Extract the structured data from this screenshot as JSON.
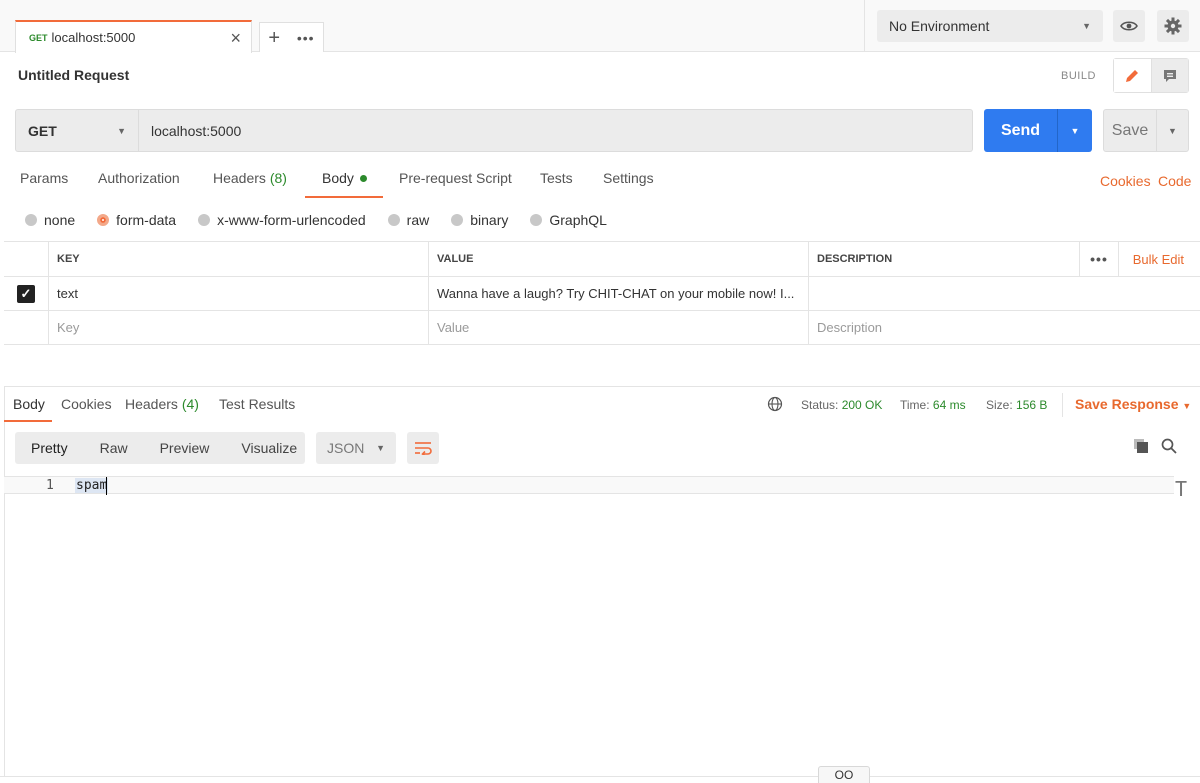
{
  "tabs": {
    "active_method": "GET",
    "active_title": "localhost:5000",
    "close_glyph": "×",
    "new_tab_glyph": "+",
    "more_glyph": "•••"
  },
  "environment": {
    "selected": "No Environment"
  },
  "request": {
    "title": "Untitled Request",
    "mode_label": "BUILD",
    "method": "GET",
    "url": "localhost:5000",
    "send_label": "Send",
    "save_label": "Save"
  },
  "request_tabs": {
    "params": "Params",
    "authorization": "Authorization",
    "headers": "Headers",
    "headers_count": "(8)",
    "body": "Body",
    "prerequest": "Pre-request Script",
    "tests": "Tests",
    "settings": "Settings",
    "cookies_link": "Cookies",
    "code_link": "Code"
  },
  "body_types": {
    "none": "none",
    "form_data": "form-data",
    "urlencoded": "x-www-form-urlencoded",
    "raw": "raw",
    "binary": "binary",
    "graphql": "GraphQL",
    "selected": "form-data"
  },
  "params_table": {
    "headers": {
      "key": "KEY",
      "value": "VALUE",
      "description": "DESCRIPTION",
      "more": "•••",
      "bulk_edit": "Bulk Edit"
    },
    "rows": [
      {
        "checked": true,
        "key": "text",
        "value": "Wanna have a laugh? Try CHIT-CHAT on your mobile now! I...",
        "description": ""
      }
    ],
    "placeholders": {
      "key": "Key",
      "value": "Value",
      "description": "Description"
    }
  },
  "response": {
    "tabs": {
      "body": "Body",
      "cookies": "Cookies",
      "headers": "Headers",
      "headers_count": "(4)",
      "test_results": "Test Results"
    },
    "status_label": "Status:",
    "status_value": "200 OK",
    "time_label": "Time:",
    "time_value": "64 ms",
    "size_label": "Size:",
    "size_value": "156 B",
    "save_response": "Save Response",
    "views": {
      "pretty": "Pretty",
      "raw": "Raw",
      "preview": "Preview",
      "visualize": "Visualize"
    },
    "format": "JSON",
    "line_number": "1",
    "body_text": "spam"
  },
  "footer": {
    "chip": "OO"
  },
  "colors": {
    "accent": "#f26b3a",
    "send": "#2f7bf0",
    "success": "#2c8a2c"
  }
}
